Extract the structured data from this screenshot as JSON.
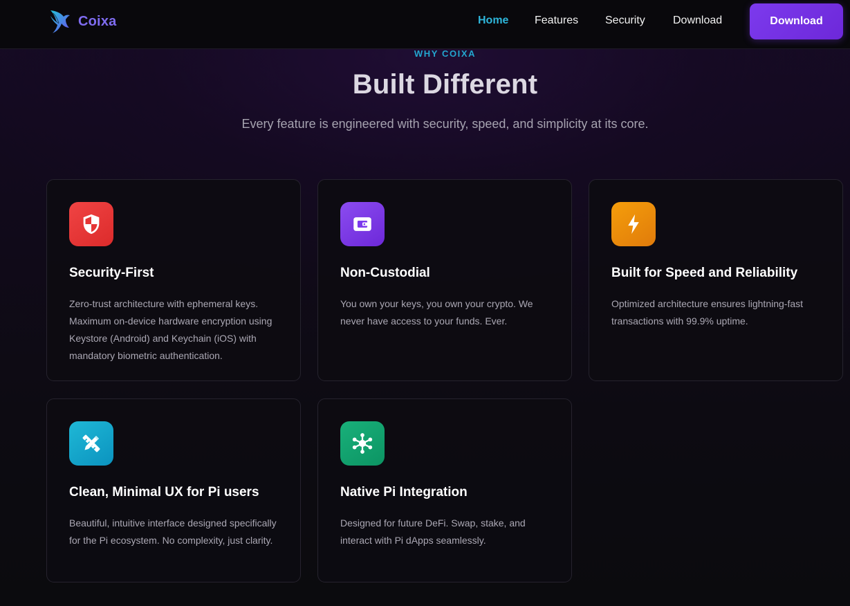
{
  "navbar": {
    "brand": "Coixa",
    "links": [
      {
        "label": "Home",
        "active": true
      },
      {
        "label": "Features",
        "active": false
      },
      {
        "label": "Security",
        "active": false
      },
      {
        "label": "Download",
        "active": false
      }
    ],
    "cta_label": "Download"
  },
  "hero": {
    "eyebrow": "WHY COIXA",
    "title": "Built Different",
    "subtitle": "Every feature is engineered with security, speed, and simplicity at its core."
  },
  "features": [
    {
      "icon": "shield-icon",
      "color": "#ef4444",
      "title": "Security-First",
      "description": "Zero-trust architecture with ephemeral keys. Maximum on-device hardware encryption using Keystore (Android) and Keychain (iOS) with mandatory biometric authentication."
    },
    {
      "icon": "wallet-icon",
      "color": "#7c3aed",
      "title": "Non-Custodial",
      "description": "You own your keys, you own your crypto. We never have access to your funds. Ever."
    },
    {
      "icon": "lightning-icon",
      "color": "#f59e0b",
      "title": "Built for Speed and Reliability",
      "description": "Optimized architecture ensures lightning-fast transactions with 99.9% uptime."
    },
    {
      "icon": "pencil-ruler-icon",
      "color": "#14b1d4",
      "title": "Clean, Minimal UX for Pi users",
      "description": "Beautiful, intuitive interface designed specifically for the Pi ecosystem. No complexity, just clarity."
    },
    {
      "icon": "network-nodes-icon",
      "color": "#10a86f",
      "title": "Native Pi Integration",
      "description": "Designed for future DeFi. Swap, stake, and interact with Pi dApps seamlessly."
    }
  ],
  "colors": {
    "accent": "#7c3aed",
    "nav_active": "#2eb6db",
    "eyebrow": "#23a6cf"
  }
}
